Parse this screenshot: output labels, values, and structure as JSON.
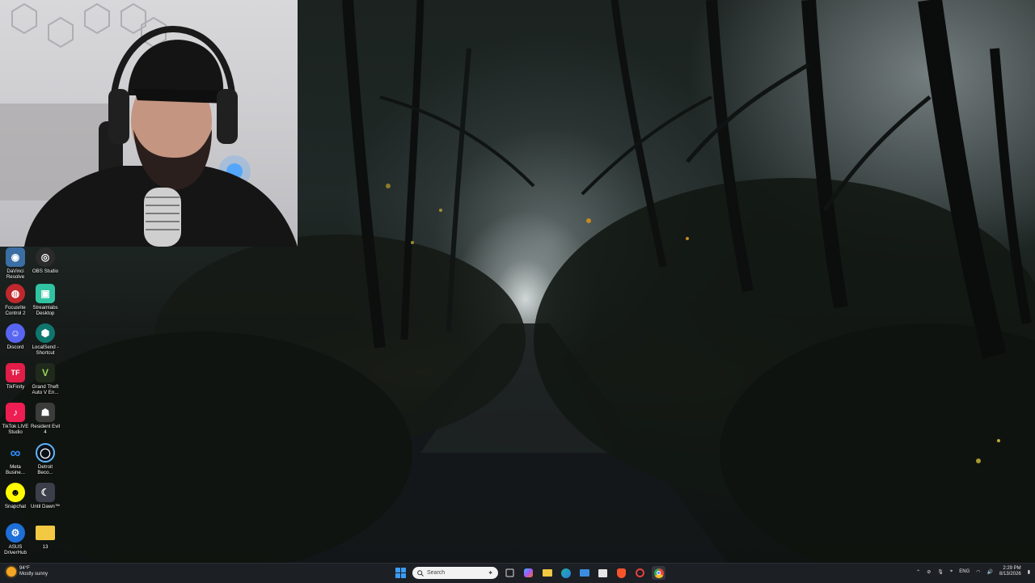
{
  "desktop": {
    "icons": [
      {
        "id": "davinci",
        "label": "DaVinci\nResolve",
        "color": "#3a6ea5",
        "glyph": "◉"
      },
      {
        "id": "obs",
        "label": "OBS Studio",
        "color": "#2b2b2b",
        "glyph": "◎"
      },
      {
        "id": "focusrite",
        "label": "Focusrite\nControl 2",
        "color": "#c0282d",
        "glyph": "◍"
      },
      {
        "id": "streamlabs",
        "label": "Streamlabs\nDesktop",
        "color": "#31c3a2",
        "glyph": "▣"
      },
      {
        "id": "discord",
        "label": "Discord",
        "color": "#5865f2",
        "glyph": "☺"
      },
      {
        "id": "localsend",
        "label": "LocalSend -\nShortcut",
        "color": "#0f766e",
        "glyph": "⬢"
      },
      {
        "id": "tikfinity",
        "label": "TikFinity",
        "color": "#e11d48",
        "glyph": "TF"
      },
      {
        "id": "gta",
        "label": "Grand Theft\nAuto V En...",
        "color": "#1f2a1c",
        "glyph": "V"
      },
      {
        "id": "tiktoklive",
        "label": "TikTok LIVE\nStudio",
        "color": "#ee1d52",
        "glyph": "♪"
      },
      {
        "id": "re4",
        "label": "Resident Evil\n4",
        "color": "#3c3c3c",
        "glyph": "☗"
      },
      {
        "id": "meta",
        "label": "Meta\nBusine...",
        "color": "#0a66ff",
        "glyph": "∞"
      },
      {
        "id": "detroit",
        "label": "Detroit\nBeco...",
        "color": "#0b0f18",
        "glyph": "◯"
      },
      {
        "id": "snapchat",
        "label": "Snapchat",
        "color": "#fffc00",
        "glyph": "👻"
      },
      {
        "id": "untildawn",
        "label": "Until Dawn™",
        "color": "#3a3f4a",
        "glyph": "☾"
      },
      {
        "id": "asus",
        "label": "ASUS\nDriverHub",
        "color": "#1e6fd9",
        "glyph": "⚙"
      },
      {
        "id": "folder13",
        "label": "13",
        "color": "#f3c843",
        "glyph": "▬"
      }
    ]
  },
  "taskbar": {
    "weather": {
      "temp": "94°F",
      "condition": "Mostly sunny",
      "icon": "sun-icon"
    },
    "search_placeholder": "Search",
    "pinned": [
      {
        "name": "start",
        "icon": "windows-logo-icon",
        "color": "#3b9cf5"
      },
      {
        "name": "task-view",
        "icon": "task-view-icon",
        "color": "#dcdcdc"
      },
      {
        "name": "copilot",
        "icon": "copilot-icon",
        "color": "#8a7cf7"
      },
      {
        "name": "file-explorer",
        "icon": "folder-icon",
        "color": "#f3c843"
      },
      {
        "name": "edge",
        "icon": "edge-icon",
        "color": "#1fb3a3"
      },
      {
        "name": "mail",
        "icon": "mail-icon",
        "color": "#3b8de0"
      },
      {
        "name": "store",
        "icon": "store-icon",
        "color": "#e6e6e6"
      },
      {
        "name": "brave",
        "icon": "brave-icon",
        "color": "#fb542b"
      },
      {
        "name": "recorder",
        "icon": "recorder-icon",
        "color": "#e64040"
      },
      {
        "name": "chrome",
        "icon": "chrome-icon",
        "color": "#e8453c"
      }
    ],
    "tray": {
      "language": "ENG",
      "time": "2:29 PM",
      "date": "8/13/2026"
    }
  }
}
